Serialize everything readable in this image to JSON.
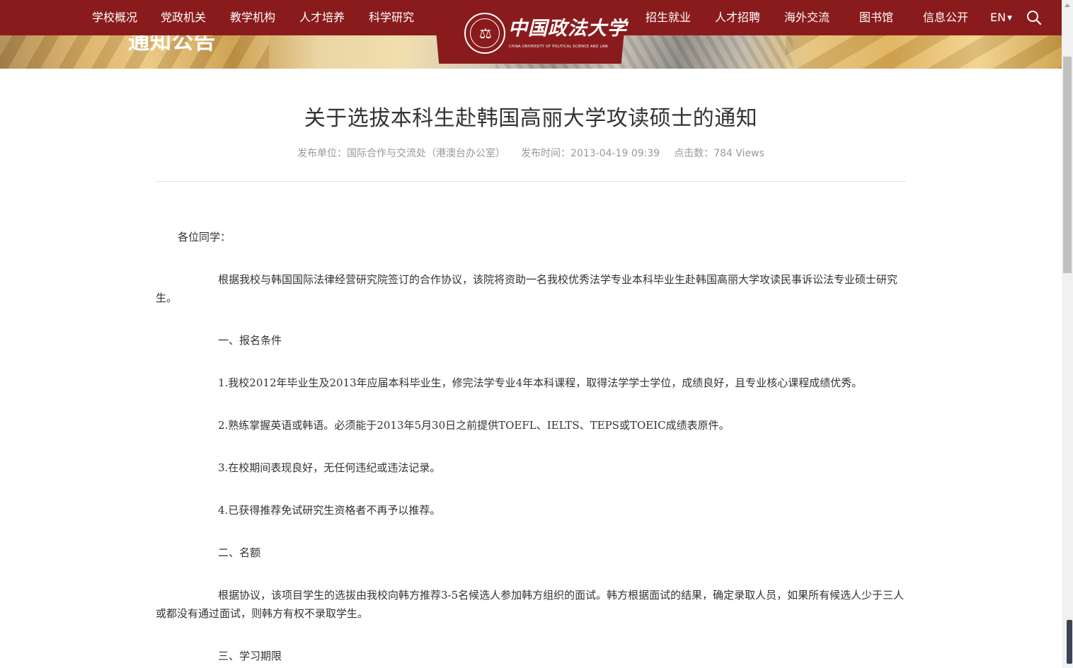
{
  "banner": {
    "title": "通知公告"
  },
  "nav": {
    "left_items": [
      "学校概况",
      "党政机关",
      "教学机构",
      "人才培养",
      "科学研究"
    ],
    "right_items": [
      "招生就业",
      "人才招聘",
      "海外交流",
      "图书馆",
      "信息公开"
    ],
    "lang": "EN",
    "logo_name": "中国政法大学",
    "logo_en": "CHINA UNIVERSITY OF POLITICAL SCIENCE AND LAW"
  },
  "article": {
    "title": "关于选拔本科生赴韩国高丽大学攻读硕士的通知",
    "meta": {
      "unit": "发布单位：国际合作与交流处（港澳台办公室）",
      "time": "发布时间：2013-04-19 09:39",
      "views": "点击数：784 Views"
    },
    "paragraphs": [
      "各位同学：",
      "根据我校与韩国国际法律经营研究院签订的合作协议，该院将资助一名我校优秀法学专业本科毕业生赴韩国高丽大学攻读民事诉讼法专业硕士研究生。",
      "一、报名条件",
      "1.我校2012年毕业生及2013年应届本科毕业生，修完法学专业4年本科课程，取得法学学士学位，成绩良好，且专业核心课程成绩优秀。",
      "2.熟练掌握英语或韩语。必须能于2013年5月30日之前提供TOEFL、IELTS、TEPS或TOEIC成绩表原件。",
      "3.在校期间表现良好，无任何违纪或违法记录。",
      "4.已获得推荐免试研究生资格者不再予以推荐。",
      "二、名额",
      "根据协议，该项目学生的选拔由我校向韩方推荐3-5名候选人参加韩方组织的面试。韩方根据面试的结果，确定录取人员，如果所有候选人少于三人或都没有通过面试，则韩方有权不录取学生。",
      "三、学习期限"
    ]
  },
  "colors": {
    "nav_bg": "#8a1b1c",
    "meta": "#999999",
    "text": "#333333"
  }
}
